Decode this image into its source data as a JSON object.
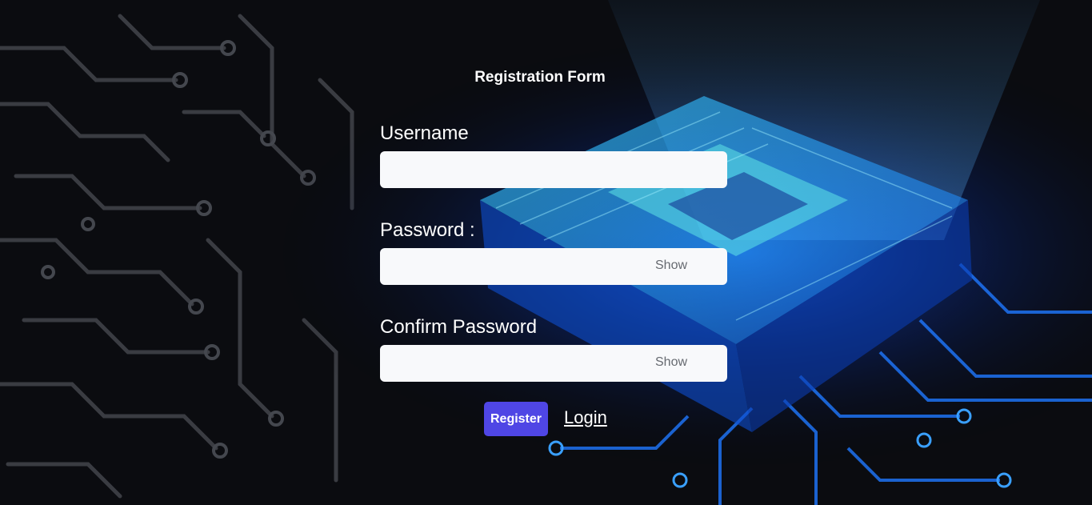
{
  "form": {
    "title": "Registration Form",
    "username_label": "Username",
    "username_value": "",
    "password_label": "Password :",
    "password_value": "",
    "password_toggle": "Show",
    "confirm_label": "Confirm Password",
    "confirm_value": "",
    "confirm_toggle": "Show",
    "register_label": "Register",
    "login_label": "Login"
  },
  "theme": {
    "accent": "#4f46e5",
    "input_bg": "#f8f9fb",
    "background": "#0b0c10",
    "chip_glow": "#1e90ff"
  },
  "background_image": "circuit-board-cpu-chip-glow"
}
